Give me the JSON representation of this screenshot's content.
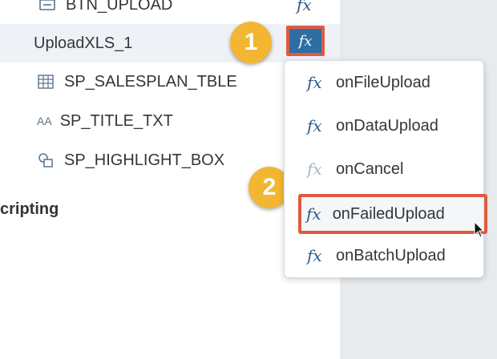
{
  "outline": {
    "items": [
      {
        "label": "BTN_UPLOAD",
        "icon": "button-icon",
        "trailing": "fx"
      },
      {
        "label": "UploadXLS_1",
        "icon": "",
        "trailing": "fx",
        "selected": true
      },
      {
        "label": "SP_SALESPLAN_TBLE",
        "icon": "table-icon"
      },
      {
        "label": "SP_TITLE_TXT",
        "icon": "text-icon",
        "icon_glyph": "AA"
      },
      {
        "label": "SP_HIGHLIGHT_BOX",
        "icon": "shapes-icon"
      }
    ],
    "section_label": "cripting"
  },
  "fx_button": {
    "label": "fx"
  },
  "badges": [
    "1",
    "2"
  ],
  "menu": {
    "items": [
      {
        "label": "onFileUpload",
        "icon": "fx",
        "disabled": false
      },
      {
        "label": "onDataUpload",
        "icon": "fx",
        "disabled": false
      },
      {
        "label": "onCancel",
        "icon": "fx",
        "disabled": true
      },
      {
        "label": "onFailedUpload",
        "icon": "fx",
        "disabled": false,
        "highlighted": true
      },
      {
        "label": "onBatchUpload",
        "icon": "fx",
        "disabled": false
      }
    ]
  },
  "colors": {
    "accent_blue": "#2d6ea3",
    "highlight_red": "#e05a3f",
    "badge_yellow": "#f2b632",
    "panel_gray": "#e8ebee"
  }
}
